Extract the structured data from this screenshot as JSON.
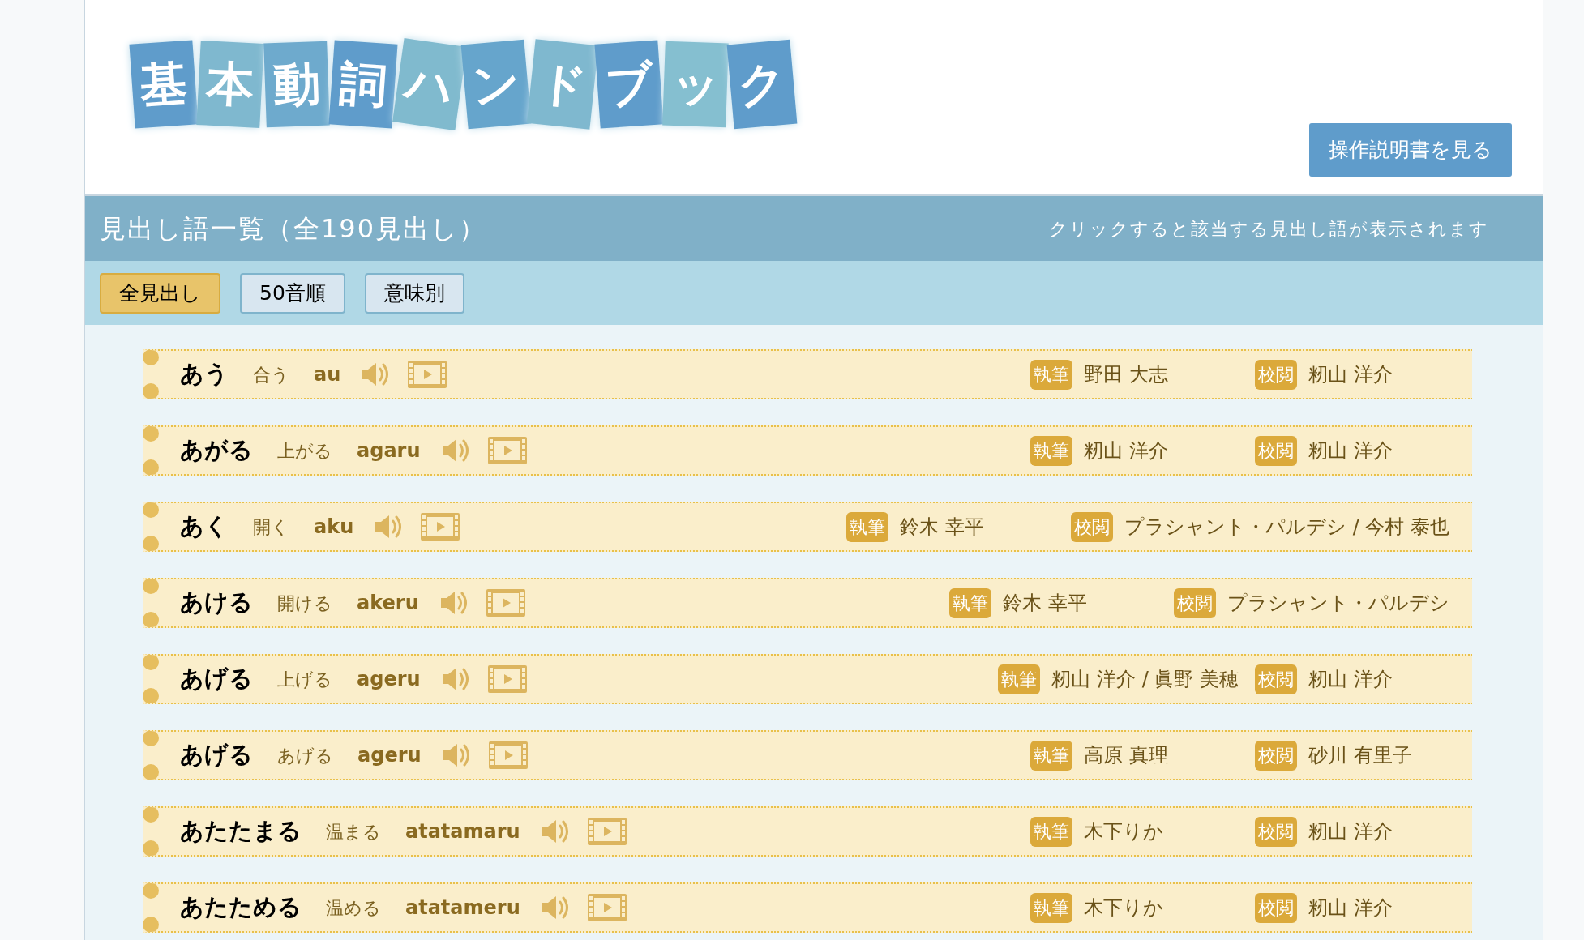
{
  "logo_tiles": [
    "基",
    "本",
    "動",
    "詞",
    "ハ",
    "ン",
    "ド",
    "ブ",
    "ッ",
    "ク"
  ],
  "manual_button": "操作説明書を見る",
  "list_header": {
    "title": "見出し語一覧（全190見出し）",
    "hint": "クリックすると該当する見出し語が表示されます"
  },
  "tabs": [
    {
      "label": "全見出し",
      "selected": true
    },
    {
      "label": "50音順",
      "selected": false
    },
    {
      "label": "意味別",
      "selected": false
    }
  ],
  "entries": [
    {
      "word": "あう",
      "kanji": "合う",
      "romaji": "au",
      "writer_label": "執筆",
      "writer": "野田 大志",
      "reviewer_label": "校閲",
      "reviewer": "籾山 洋介"
    },
    {
      "word": "あがる",
      "kanji": "上がる",
      "romaji": "agaru",
      "writer_label": "執筆",
      "writer": "籾山 洋介",
      "reviewer_label": "校閲",
      "reviewer": "籾山 洋介"
    },
    {
      "word": "あく",
      "kanji": "開く",
      "romaji": "aku",
      "writer_label": "執筆",
      "writer": "鈴木 幸平",
      "reviewer_label": "校閲",
      "reviewer": "プラシャント・パルデシ / 今村 泰也"
    },
    {
      "word": "あける",
      "kanji": "開ける",
      "romaji": "akeru",
      "writer_label": "執筆",
      "writer": "鈴木 幸平",
      "reviewer_label": "校閲",
      "reviewer": "プラシャント・パルデシ"
    },
    {
      "word": "あげる",
      "kanji": "上げる",
      "romaji": "ageru",
      "writer_label": "執筆",
      "writer": "籾山 洋介 / 眞野 美穂",
      "reviewer_label": "校閲",
      "reviewer": "籾山 洋介"
    },
    {
      "word": "あげる",
      "kanji": "あげる",
      "romaji": "ageru",
      "writer_label": "執筆",
      "writer": "高原 真理",
      "reviewer_label": "校閲",
      "reviewer": "砂川 有里子"
    },
    {
      "word": "あたたまる",
      "kanji": "温まる",
      "romaji": "atatamaru",
      "writer_label": "執筆",
      "writer": "木下りか",
      "reviewer_label": "校閲",
      "reviewer": "籾山 洋介"
    },
    {
      "word": "あたためる",
      "kanji": "温める",
      "romaji": "atatameru",
      "writer_label": "執筆",
      "writer": "木下りか",
      "reviewer_label": "校閲",
      "reviewer": "籾山 洋介"
    }
  ]
}
